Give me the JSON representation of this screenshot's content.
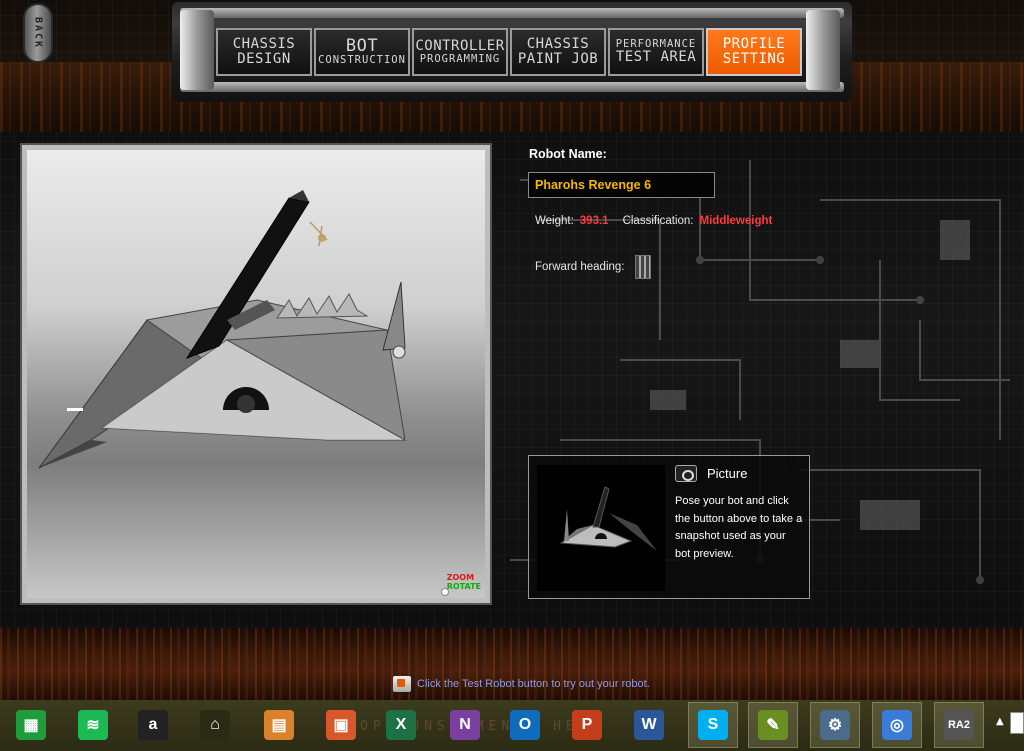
{
  "nav": {
    "back_label": "BACK",
    "tabs": [
      {
        "line1": "CHASSIS",
        "line2": "DESIGN",
        "active": false
      },
      {
        "line1": "BOT",
        "line2": "CONSTRUCTION",
        "active": false
      },
      {
        "line1": "CONTROLLER",
        "line2": "PROGRAMMING",
        "active": false
      },
      {
        "line1": "CHASSIS",
        "line2": "PAINT JOB",
        "active": false
      },
      {
        "line1": "PERFORMANCE",
        "line2": "TEST AREA",
        "active": false
      },
      {
        "line1": "PROFILE",
        "line2": "SETTING",
        "active": true
      }
    ]
  },
  "viewer": {
    "zoom_label": "ZOOM",
    "rotate_label": "ROTATE"
  },
  "robot": {
    "name_label": "Robot Name:",
    "name_value": "Pharohs Revenge 6",
    "weight_label": "Weight:",
    "weight_value": "393.1",
    "classification_label": "Classification:",
    "classification_value": "Middleweight",
    "heading_label": "Forward heading:"
  },
  "picture": {
    "title": "Picture",
    "description": "Pose your bot and click the button above to take a snapshot used as your bot preview."
  },
  "hint": {
    "text": "Click the Test Robot button to try out your robot."
  },
  "menu_strip": [
    "OPTIONS",
    "MENU",
    "HELP"
  ],
  "taskbar": {
    "items": [
      {
        "icon": "store-icon",
        "color": "#1f9d3c",
        "glyph": "▦"
      },
      {
        "icon": "spotify-icon",
        "color": "#1db954",
        "glyph": "≋"
      },
      {
        "icon": "amazon-icon",
        "color": "#222222",
        "glyph": "a"
      },
      {
        "icon": "home-icon",
        "color": "#2b2a14",
        "glyph": "⌂"
      },
      {
        "icon": "files-icon",
        "color": "#d9822b",
        "glyph": "▤"
      },
      {
        "icon": "photos-icon",
        "color": "#d9582b",
        "glyph": "▣"
      },
      {
        "icon": "excel-icon",
        "color": "#1e7145",
        "glyph": "X"
      },
      {
        "icon": "onenote-icon",
        "color": "#7b3fa0",
        "glyph": "N"
      },
      {
        "icon": "outlook-icon",
        "color": "#0f6cbd",
        "glyph": "O"
      },
      {
        "icon": "powerpoint-icon",
        "color": "#c43e1c",
        "glyph": "P"
      },
      {
        "icon": "word-icon",
        "color": "#2b579a",
        "glyph": "W"
      },
      {
        "icon": "skype-icon",
        "color": "#00aff0",
        "glyph": "S"
      },
      {
        "icon": "notepad-icon",
        "color": "#6b8e23",
        "glyph": "✎"
      },
      {
        "icon": "network-icon",
        "color": "#4a6b8a",
        "glyph": "⚙"
      },
      {
        "icon": "browser-icon",
        "color": "#3a7bd5",
        "glyph": "◎"
      },
      {
        "icon": "ra2-icon",
        "color": "#555555",
        "glyph": "RA2"
      }
    ]
  },
  "colors": {
    "accent": "#ff7a1c",
    "name_text": "#f5b800",
    "stat_value": "#ff3b3b",
    "hint_text": "#8f9be0"
  }
}
